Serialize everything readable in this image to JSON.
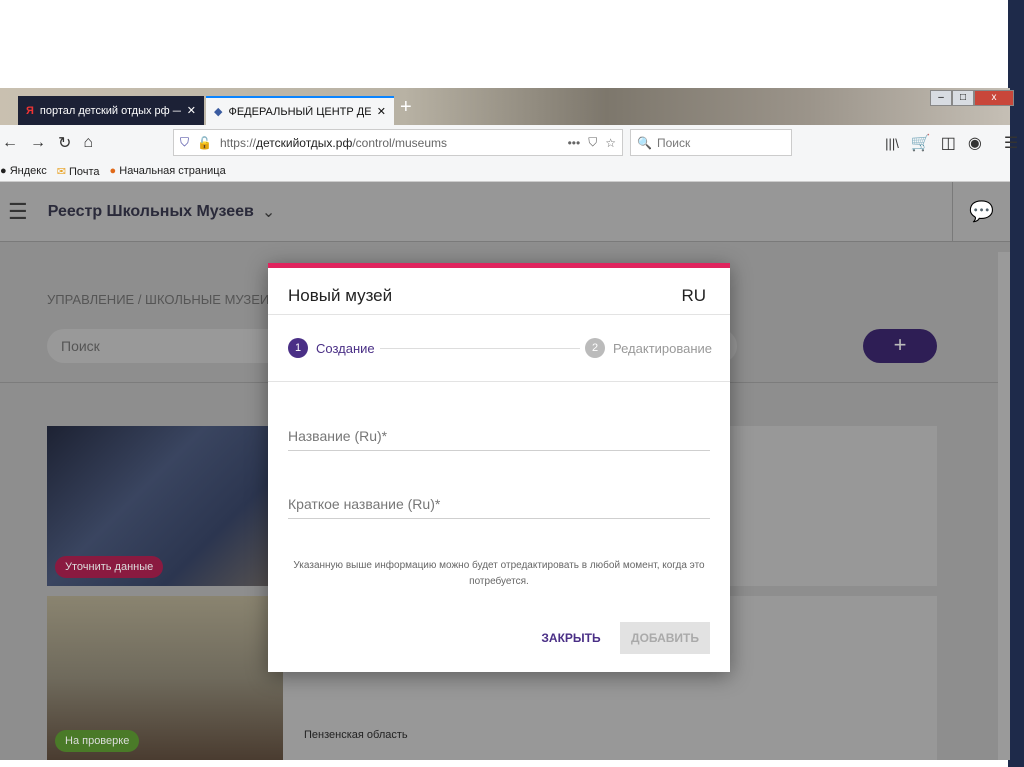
{
  "browser": {
    "tabs": [
      {
        "label": "портал детский отдых рф — Я",
        "icon": "yandex-icon"
      },
      {
        "label": "ФЕДЕРАЛЬНЫЙ ЦЕНТР ДЕТС",
        "icon": "site-icon"
      }
    ],
    "new_tab": "+",
    "url_bold": "детскийотдых.рф",
    "url_prefix": "https://",
    "url_suffix": "/control/museums",
    "search_placeholder": "Поиск",
    "bookmarks": [
      "Яндекс",
      "Почта",
      "Начальная страница"
    ],
    "window": {
      "minimize": "–",
      "maximize": "□",
      "close": "x"
    }
  },
  "app": {
    "title": "Реестр Школьных Музеев",
    "breadcrumb": "УПРАВЛЕНИЕ / ШКОЛЬНЫЕ МУЗЕИ",
    "search_placeholder": "Поиск",
    "add": "+",
    "cards": [
      {
        "badge": "Уточнить данные",
        "badge_color": "#b3194a"
      },
      {
        "badge": "На проверке",
        "badge_color": "#4e8a1f",
        "region": "Пензенская область"
      }
    ]
  },
  "modal": {
    "title": "Новый музей",
    "lang": "RU",
    "steps": [
      {
        "num": "1",
        "label": "Создание"
      },
      {
        "num": "2",
        "label": "Редактирование"
      }
    ],
    "fields": [
      {
        "label": "Название (Ru)*"
      },
      {
        "label": "Краткое название (Ru)*"
      }
    ],
    "note": "Указанную выше информацию можно будет отредактировать в любой момент, когда это потребуется.",
    "close": "ЗАКРЫТЬ",
    "add": "ДОБАВИТЬ",
    "accent": "#e0245e",
    "primary": "#4a2f86"
  }
}
